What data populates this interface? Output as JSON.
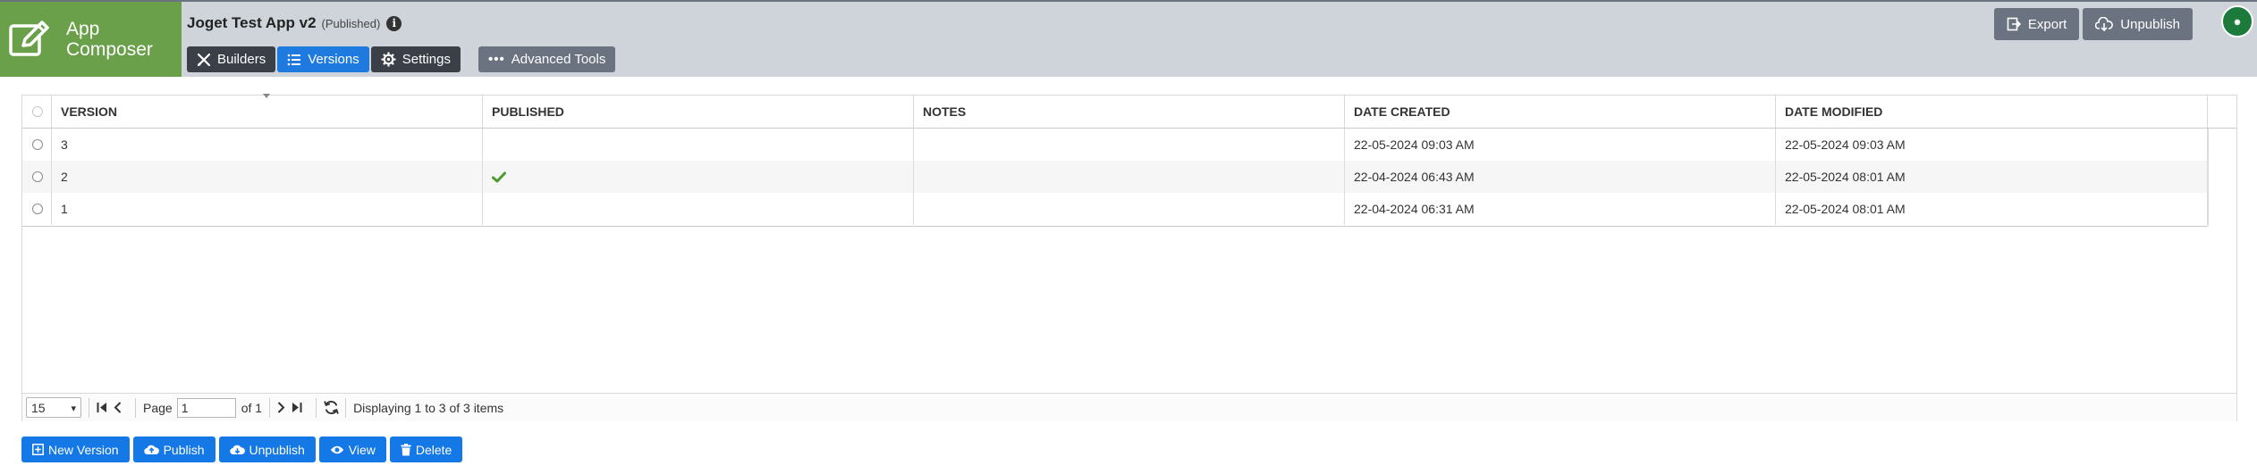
{
  "brand": {
    "line1": "App",
    "line2": "Composer",
    "color": "#6aa04a"
  },
  "app": {
    "title": "Joget Test App v2",
    "status": "(Published)"
  },
  "tabs": [
    {
      "label": "Builders",
      "icon": "tools-icon",
      "active": false
    },
    {
      "label": "Versions",
      "icon": "list-icon",
      "active": true
    },
    {
      "label": "Settings",
      "icon": "gear-icon",
      "active": false
    }
  ],
  "advanced_tools_label": "Advanced Tools",
  "header_buttons": {
    "export": "Export",
    "unpublish": "Unpublish"
  },
  "grid": {
    "columns": [
      "VERSION",
      "PUBLISHED",
      "NOTES",
      "DATE CREATED",
      "DATE MODIFIED"
    ],
    "rows": [
      {
        "version": "3",
        "published": false,
        "notes": "",
        "date_created": "22-05-2024 09:03 AM",
        "date_modified": "22-05-2024 09:03 AM"
      },
      {
        "version": "2",
        "published": true,
        "notes": "",
        "date_created": "22-04-2024 06:43 AM",
        "date_modified": "22-05-2024 08:01 AM"
      },
      {
        "version": "1",
        "published": false,
        "notes": "",
        "date_created": "22-04-2024 06:31 AM",
        "date_modified": "22-05-2024 08:01 AM"
      }
    ]
  },
  "pager": {
    "page_size": "15",
    "page_label": "Page",
    "page_value": "1",
    "of_label": "of 1",
    "display_text": "Displaying 1 to 3 of 3 items"
  },
  "actions": {
    "new_version": "New Version",
    "publish": "Publish",
    "unpublish": "Unpublish",
    "view": "View",
    "delete": "Delete"
  },
  "colors": {
    "accent": "#1478e6",
    "tab_active": "#1f7ae0",
    "header_bg": "#cfd4db",
    "check": "#4a9a2e"
  }
}
